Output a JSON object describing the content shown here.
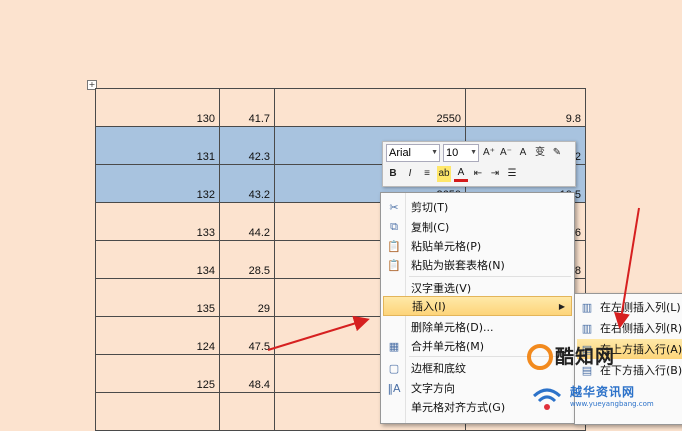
{
  "table": {
    "rows": [
      {
        "c1": "130",
        "c2": "41.7",
        "c3": "2550",
        "c4": "9.8",
        "selected": false
      },
      {
        "c1": "131",
        "c2": "42.3",
        "c3": "",
        "c4": "2",
        "selected": true
      },
      {
        "c1": "132",
        "c2": "43.2",
        "c3": "2650",
        "c4": "10.5",
        "selected": true
      },
      {
        "c1": "133",
        "c2": "44.2",
        "c3": "",
        "c4": ".6",
        "selected": false
      },
      {
        "c1": "134",
        "c2": "28.5",
        "c3": "",
        "c4": ".8",
        "selected": false
      },
      {
        "c1": "135",
        "c2": "29",
        "c3": "",
        "c4": "",
        "selected": false
      },
      {
        "c1": "124",
        "c2": "47.5",
        "c3": "",
        "c4": "",
        "selected": false
      },
      {
        "c1": "125",
        "c2": "48.4",
        "c3": "",
        "c4": "",
        "selected": false
      },
      {
        "c1": "",
        "c2": "",
        "c3": "",
        "c4": "",
        "selected": false
      }
    ]
  },
  "mini_toolbar": {
    "font_name": "Arial",
    "font_size": "10",
    "grow_font": "A⁺",
    "shrink_font": "A⁻",
    "styles": "A",
    "phonetic": "变",
    "format_painter": "✎",
    "bold": "B",
    "italic": "I",
    "center": "≡",
    "highlight": "ab",
    "font_color": "A",
    "decrease_indent": "⇤",
    "increase_indent": "⇥",
    "bullets": "☰"
  },
  "context_menu": {
    "items": [
      {
        "label": "剪切(T)",
        "icon": "✂"
      },
      {
        "label": "复制(C)",
        "icon": "⧉"
      },
      {
        "label": "粘贴单元格(P)",
        "icon": "📋"
      },
      {
        "label": "粘贴为嵌套表格(N)",
        "icon": "📋"
      },
      {
        "label": "汉字重选(V)",
        "icon": ""
      },
      {
        "label": "插入(I)",
        "icon": ""
      },
      {
        "label": "删除单元格(D)...",
        "icon": ""
      },
      {
        "label": "合并单元格(M)",
        "icon": "▦"
      },
      {
        "label": "边框和底纹",
        "icon": "▢"
      },
      {
        "label": "文字方向",
        "icon": "‖A"
      },
      {
        "label": "单元格对齐方式(G)",
        "icon": ""
      }
    ]
  },
  "submenu": {
    "items": [
      {
        "label": "在左侧插入列(L)",
        "icon": "▥"
      },
      {
        "label": "在右侧插入列(R)",
        "icon": "▥"
      },
      {
        "label": "在上方插入行(A)",
        "icon": "▤"
      },
      {
        "label": "在下方插入行(B)",
        "icon": "▤"
      }
    ]
  },
  "watermark": {
    "logo": "酷知网",
    "site": "越华资讯网",
    "url": "www.yueyangbang.com"
  },
  "colors": {
    "background": "#fce3cf",
    "selection": "#a8c3df",
    "menu_highlight": "#fdd47a",
    "arrow": "#d62020"
  }
}
